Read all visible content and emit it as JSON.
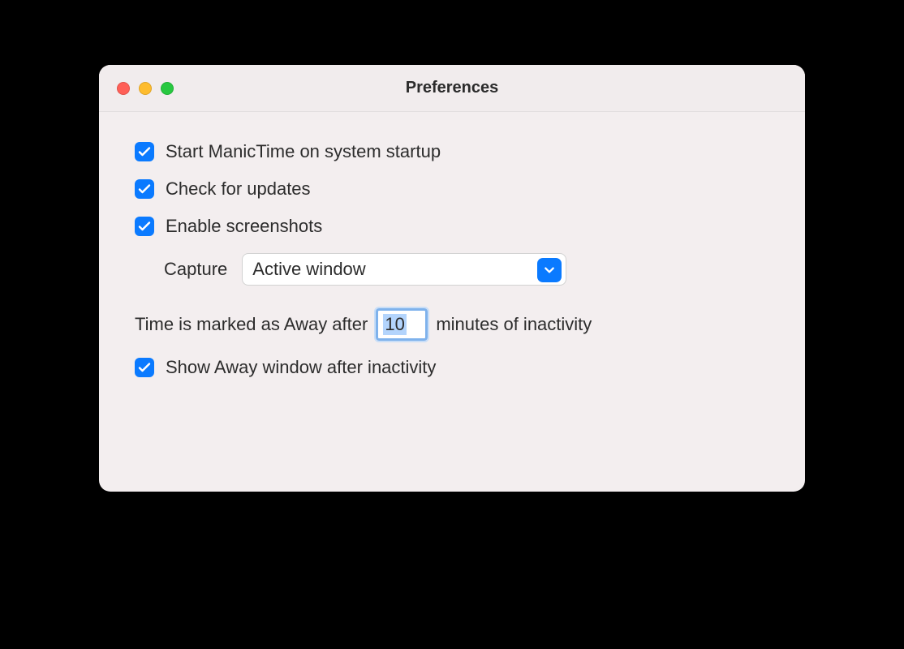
{
  "window": {
    "title": "Preferences"
  },
  "options": {
    "start_on_startup": {
      "checked": true,
      "label": "Start ManicTime on system startup"
    },
    "check_updates": {
      "checked": true,
      "label": "Check for updates"
    },
    "enable_screenshots": {
      "checked": true,
      "label": "Enable screenshots"
    },
    "capture_label": "Capture",
    "capture_value": "Active window",
    "away_prefix": "Time is marked as Away after",
    "away_value": "10",
    "away_suffix": "minutes of inactivity",
    "show_away_window": {
      "checked": true,
      "label": "Show Away window after inactivity"
    }
  }
}
